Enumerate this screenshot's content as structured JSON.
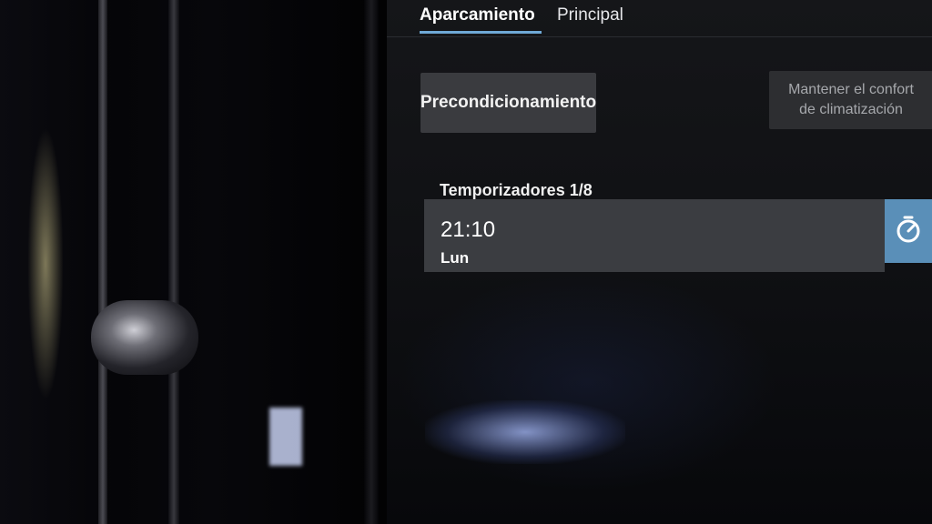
{
  "tabs": [
    {
      "label": "Aparcamiento",
      "active": true
    },
    {
      "label": "Principal",
      "active": false
    }
  ],
  "buttons": {
    "preconditioning": "Precondicionamiento",
    "keep_comfort_line1": "Mantener el confort",
    "keep_comfort_line2": "de climatización"
  },
  "timers": {
    "title": "Temporizadores 1/8",
    "items": [
      {
        "time": "21:10",
        "day": "Lun",
        "icon": "timer-icon"
      }
    ]
  },
  "colors": {
    "accent": "#6fa9d6",
    "timer_button": "#5a8fb8",
    "row_background": "#3b3d41"
  }
}
